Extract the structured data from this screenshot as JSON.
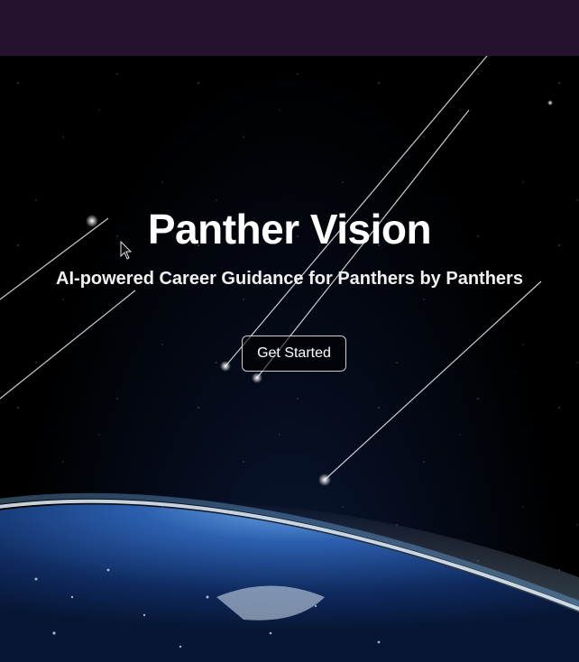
{
  "hero": {
    "title": "Panther Vision",
    "subtitle": "AI-powered Career Guidance for Panthers by Panthers",
    "cta_label": "Get Started"
  },
  "colors": {
    "topbar": "#24122e",
    "space": "#000000",
    "earth_glow": "#bfe3ff"
  }
}
